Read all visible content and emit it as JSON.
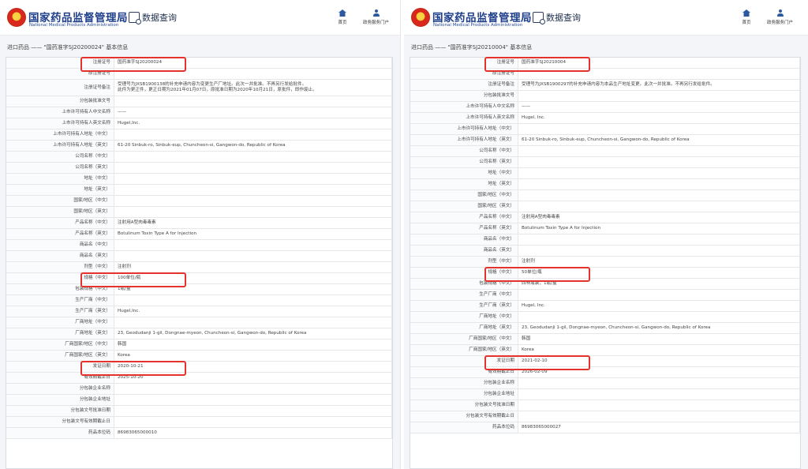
{
  "panels": [
    {
      "header": {
        "brand_cn": "国家药品监督管理局",
        "brand_en": "National Medical Products Administration",
        "query": "数据查询",
        "nav_home": "首页",
        "nav_user": "政务服务门户"
      },
      "breadcrumb": "进口药品 —— \"国药准字SJ20200024\" 基本信息",
      "rows": [
        {
          "label": "注册证号",
          "value": "国药准字SJ20200024",
          "highlight": true
        },
        {
          "label": "原注册证号",
          "value": ""
        },
        {
          "label": "注册证号备注",
          "lines": [
            "受理号为JXSB1900138的补充申请内容为变更生产厂地址。此次一并批准。不再另行发给批件。",
            "此件为更正件，更正日期为2021年01月07日，原批准日期为2020年10月21日，原批件，即作废止。"
          ]
        },
        {
          "label": "分包装批准文号",
          "value": ""
        },
        {
          "label": "上市许可持有人中文名称",
          "value": "——"
        },
        {
          "label": "上市许可持有人英文名称",
          "value": "Hugel,Inc."
        },
        {
          "label": "上市许可持有人地址（中文）",
          "value": ""
        },
        {
          "label": "上市许可持有人地址（英文）",
          "value": "61-20 Sinbuk-ro, Sinbuk-eup, Chuncheon-si, Gangwon-do, Republic of Korea"
        },
        {
          "label": "公司名称（中文）",
          "value": ""
        },
        {
          "label": "公司名称（英文）",
          "value": ""
        },
        {
          "label": "地址（中文）",
          "value": ""
        },
        {
          "label": "地址（英文）",
          "value": ""
        },
        {
          "label": "国家/地区（中文）",
          "value": ""
        },
        {
          "label": "国家/地区（英文）",
          "value": ""
        },
        {
          "label": "产品名称（中文）",
          "value": "注射用A型肉毒毒素"
        },
        {
          "label": "产品名称（英文）",
          "value": "Botulinum Toxin Type A for Injection"
        },
        {
          "label": "商品名（中文）",
          "value": ""
        },
        {
          "label": "商品名（英文）",
          "value": ""
        },
        {
          "label": "剂型（中文）",
          "value": "注射剂"
        },
        {
          "label": "规格（中文）",
          "value": "100单位/瓶",
          "highlight": true
        },
        {
          "label": "包装规格（中文）",
          "value": "1瓶/盒"
        },
        {
          "label": "生产厂商（中文）",
          "value": ""
        },
        {
          "label": "生产厂商（英文）",
          "value": "Hugel,Inc."
        },
        {
          "label": "厂商地址（中文）",
          "value": ""
        },
        {
          "label": "厂商地址（英文）",
          "value": "23, Geodudanji 1-gil, Dongnae-myeon, Chuncheon-si, Gangwon-do, Republic of Korea"
        },
        {
          "label": "厂商国家/地区（中文）",
          "value": "韩国"
        },
        {
          "label": "厂商国家/地区（英文）",
          "value": "Korea"
        },
        {
          "label": "发证日期",
          "value": "2020-10-21",
          "highlight": true
        },
        {
          "label": "有效期截止日",
          "value": "2025-10-20"
        },
        {
          "label": "分包装企业名称",
          "value": ""
        },
        {
          "label": "分包装企业地址",
          "value": ""
        },
        {
          "label": "分包装文号批准日期",
          "value": ""
        },
        {
          "label": "分包装文号有效期截止日",
          "value": ""
        },
        {
          "label": "药品本位码",
          "value": "86983065000010"
        }
      ]
    },
    {
      "header": {
        "brand_cn": "国家药品监督管理局",
        "brand_en": "National Medical Products Administration",
        "query": "数据查询",
        "nav_home": "首页",
        "nav_user": "政务服务门户"
      },
      "breadcrumb": "进口药品 —— \"国药准字SJ20210004\" 基本信息",
      "rows": [
        {
          "label": "注册证号",
          "value": "国药准字SJ20210004",
          "highlight": true
        },
        {
          "label": "原注册证号",
          "value": ""
        },
        {
          "label": "注册证号备注",
          "value": "受理号为JXSB1900297的补充申请内容为本品生产地址变更。此次一并批准。不再另行发给批件。"
        },
        {
          "label": "分包装批准文号",
          "value": ""
        },
        {
          "label": "上市许可持有人中文名称",
          "value": "——"
        },
        {
          "label": "上市许可持有人英文名称",
          "value": "Hugel, Inc."
        },
        {
          "label": "上市许可持有人地址（中文）",
          "value": ""
        },
        {
          "label": "上市许可持有人地址（英文）",
          "value": "61-20 Sinbuk-ro, Sinbuk-eup, Chuncheon-si, Gangwon-do, Republic of Korea"
        },
        {
          "label": "公司名称（中文）",
          "value": ""
        },
        {
          "label": "公司名称（英文）",
          "value": ""
        },
        {
          "label": "地址（中文）",
          "value": ""
        },
        {
          "label": "地址（英文）",
          "value": ""
        },
        {
          "label": "国家/地区（中文）",
          "value": ""
        },
        {
          "label": "国家/地区（英文）",
          "value": ""
        },
        {
          "label": "产品名称（中文）",
          "value": "注射用A型肉毒毒素"
        },
        {
          "label": "产品名称（英文）",
          "value": "Botulinum Toxin Type A for Injection"
        },
        {
          "label": "商品名（中文）",
          "value": ""
        },
        {
          "label": "商品名（英文）",
          "value": ""
        },
        {
          "label": "剂型（中文）",
          "value": "注射剂"
        },
        {
          "label": "规格（中文）",
          "value": "50单位/瓶",
          "highlight": true
        },
        {
          "label": "包装规格（中文）",
          "value": "西林瓶装，1瓶/盒"
        },
        {
          "label": "生产厂商（中文）",
          "value": ""
        },
        {
          "label": "生产厂商（英文）",
          "value": "Hugel, Inc."
        },
        {
          "label": "厂商地址（中文）",
          "value": ""
        },
        {
          "label": "厂商地址（英文）",
          "value": "23, Geodudanji 1-gil, Dongnae-myeon, Chuncheon-si, Gangwon-do, Republic of Korea"
        },
        {
          "label": "厂商国家/地区（中文）",
          "value": "韩国"
        },
        {
          "label": "厂商国家/地区（英文）",
          "value": "Korea"
        },
        {
          "label": "发证日期",
          "value": "2021-02-10",
          "highlight": true
        },
        {
          "label": "有效期截止日",
          "value": "2026-02-09"
        },
        {
          "label": "分包装企业名称",
          "value": ""
        },
        {
          "label": "分包装企业地址",
          "value": ""
        },
        {
          "label": "分包装文号批准日期",
          "value": ""
        },
        {
          "label": "分包装文号有效期截止日",
          "value": ""
        },
        {
          "label": "药品本位码",
          "value": "86983065000027"
        }
      ]
    }
  ],
  "colors": {
    "highlight": "#e3332c",
    "brand": "#1f3f8c"
  }
}
